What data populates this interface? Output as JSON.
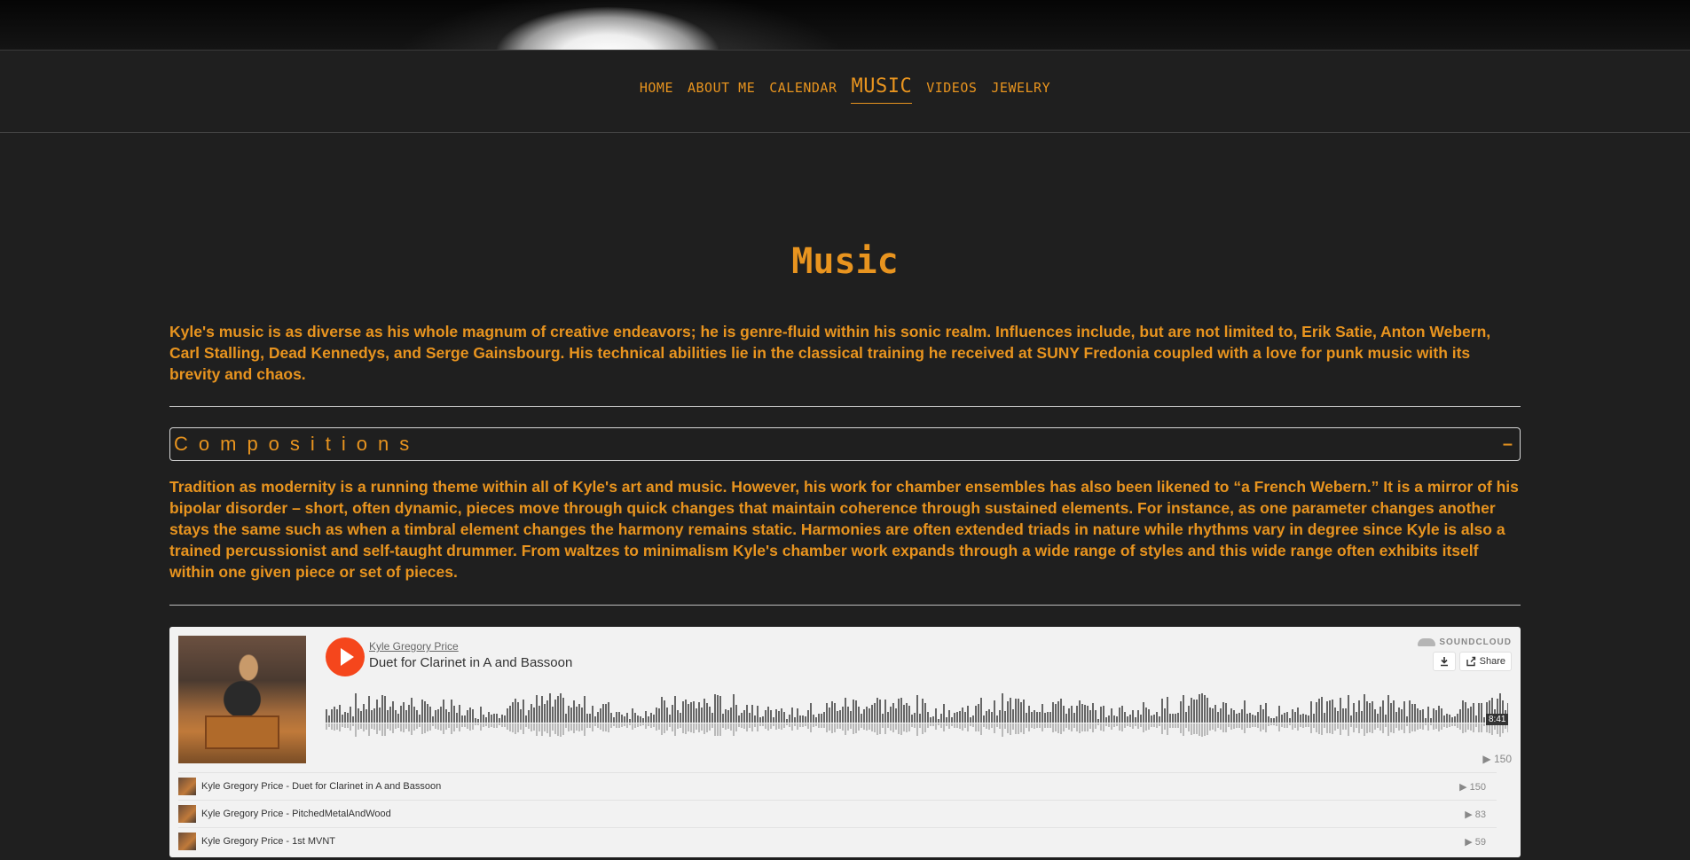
{
  "nav": {
    "items": [
      {
        "label": "HOME",
        "active": false
      },
      {
        "label": "ABOUT ME",
        "active": false
      },
      {
        "label": "CALENDAR",
        "active": false
      },
      {
        "label": "MUSIC",
        "active": true
      },
      {
        "label": "VIDEOS",
        "active": false
      },
      {
        "label": "JEWELRY",
        "active": false
      }
    ]
  },
  "page": {
    "title": "Music",
    "intro": "Kyle's music is as diverse as his whole magnum of creative endeavors; he is genre-fluid within his sonic realm. Influences include, but are not limited to, Erik Satie, Anton Webern, Carl Stalling, Dead Kennedys, and Serge Gainsbourg. His technical abilities lie in the classical training he received at SUNY Fredonia coupled with a love for punk music with its brevity and chaos."
  },
  "compositions": {
    "title": "Compositions",
    "toggle": "–",
    "text": "Tradition as modernity is a running theme within all of Kyle's art and music. However, his work for chamber ensembles has also been likened to “a French Webern.” It is a mirror of his bipolar disorder – short, often dynamic, pieces move through quick changes that maintain coherence through sustained elements. For instance, as one parameter changes another stays the same such as when a timbral element changes the harmony remains static. Harmonies are often extended triads in nature while rhythms vary in degree since Kyle is also a trained percussionist and self-taught drummer. From waltzes to minimalism Kyle's chamber work expands through a wide range of styles and this wide range often exhibits itself within one given piece or set of pieces."
  },
  "soundcloud": {
    "artist": "Kyle Gregory Price",
    "track": "Duet for Clarinet in A and Bassoon",
    "logo": "SOUNDCLOUD",
    "download_icon": "download-icon",
    "share_label": "Share",
    "duration": "8:41",
    "plays": "150",
    "tracks": [
      {
        "title": "Kyle Gregory Price - Duet for Clarinet in A and Bassoon",
        "plays": "150"
      },
      {
        "title": "Kyle Gregory Price - PitchedMetalAndWood",
        "plays": "83"
      },
      {
        "title": "Kyle Gregory Price - 1st MVNT",
        "plays": "59"
      }
    ]
  },
  "colors": {
    "background": "#1f1f1f",
    "accent": "#e8941f",
    "soundcloud_orange": "#f5461c"
  }
}
